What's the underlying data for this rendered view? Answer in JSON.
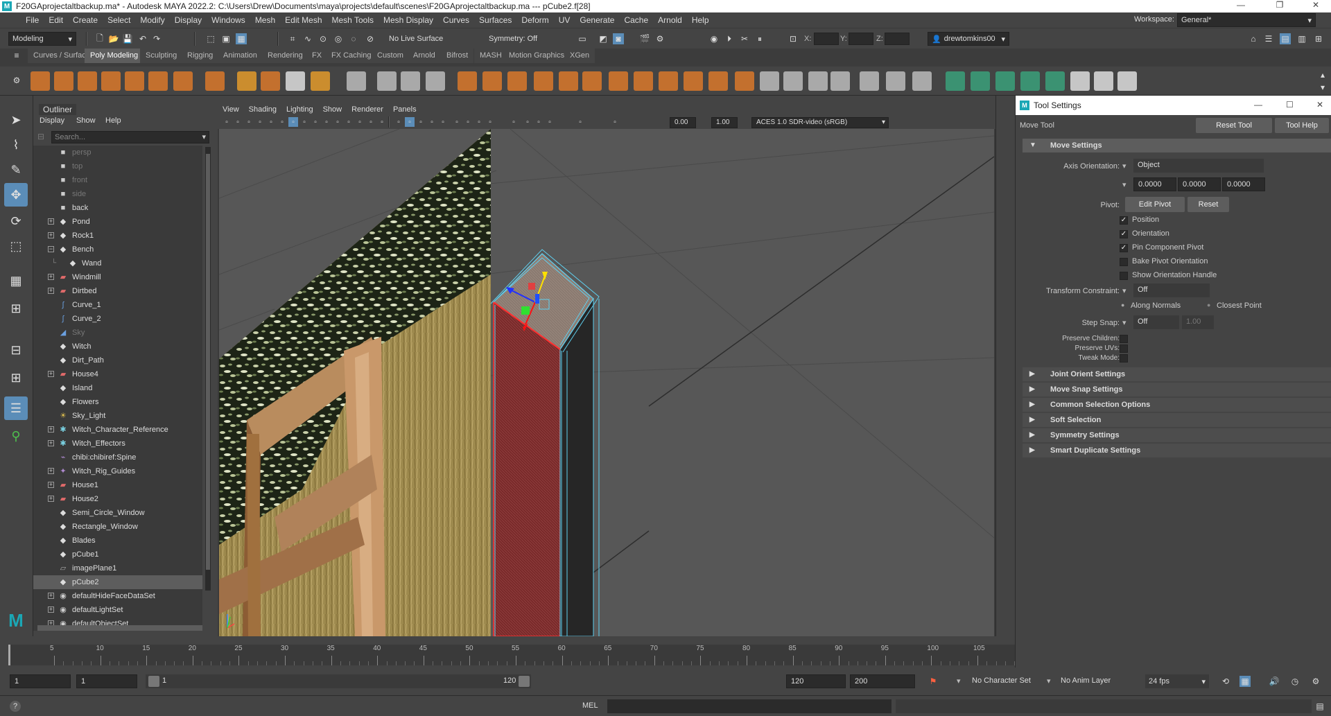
{
  "window": {
    "title": "F20GAprojectaltbackup.ma* - Autodesk MAYA 2022.2: C:\\Users\\Drew\\Documents\\maya\\projects\\default\\scenes\\F20GAprojectaltbackup.ma  ---  pCube2.f[28]",
    "workspace_label": "Workspace:",
    "workspace_value": "General*"
  },
  "menubar": [
    "File",
    "Edit",
    "Create",
    "Select",
    "Modify",
    "Display",
    "Windows",
    "Mesh",
    "Edit Mesh",
    "Mesh Tools",
    "Mesh Display",
    "Curves",
    "Surfaces",
    "Deform",
    "UV",
    "Generate",
    "Cache",
    "Arnold",
    "Help"
  ],
  "statusline": {
    "mode": "Modeling",
    "live_surface": "No Live Surface",
    "symmetry": "Symmetry: Off",
    "x_label": "X:",
    "y_label": "Y:",
    "z_label": "Z:",
    "user": "drewtomkins00"
  },
  "shelf_tabs": [
    "Curves / Surfaces",
    "Poly Modeling",
    "Sculpting",
    "Rigging",
    "Animation",
    "Rendering",
    "FX",
    "FX Caching",
    "Custom",
    "Arnold",
    "Bifrost",
    "MASH",
    "Motion Graphics",
    "XGen"
  ],
  "shelf_active": "Poly Modeling",
  "outliner": {
    "title": "Outliner",
    "menus": [
      "Display",
      "Show",
      "Help"
    ],
    "search_placeholder": "Search...",
    "items": [
      {
        "label": "persp",
        "icon": "camera-icon",
        "dim": true,
        "exp": false,
        "indent": 0
      },
      {
        "label": "top",
        "icon": "camera-icon",
        "dim": true,
        "exp": false,
        "indent": 0
      },
      {
        "label": "front",
        "icon": "camera-icon",
        "dim": true,
        "exp": false,
        "indent": 0
      },
      {
        "label": "side",
        "icon": "camera-icon",
        "dim": true,
        "exp": false,
        "indent": 0
      },
      {
        "label": "back",
        "icon": "camera-icon",
        "dim": false,
        "exp": false,
        "indent": 0
      },
      {
        "label": "Pond",
        "icon": "transform-icon",
        "dim": false,
        "exp": true,
        "indent": 0
      },
      {
        "label": "Rock1",
        "icon": "transform-icon",
        "dim": false,
        "exp": true,
        "indent": 0
      },
      {
        "label": "Bench",
        "icon": "transform-icon",
        "dim": false,
        "exp": "open",
        "indent": 0
      },
      {
        "label": "Wand",
        "icon": "transform-icon",
        "dim": false,
        "exp": false,
        "indent": 1
      },
      {
        "label": "Windmill",
        "icon": "mesh-icon",
        "dim": false,
        "exp": true,
        "indent": 0
      },
      {
        "label": "Dirtbed",
        "icon": "mesh-icon",
        "dim": false,
        "exp": true,
        "indent": 0
      },
      {
        "label": "Curve_1",
        "icon": "curve-icon",
        "dim": false,
        "exp": false,
        "indent": 0
      },
      {
        "label": "Curve_2",
        "icon": "curve-icon",
        "dim": false,
        "exp": false,
        "indent": 0
      },
      {
        "label": "Sky",
        "icon": "sky-icon",
        "dim": true,
        "exp": false,
        "indent": 0
      },
      {
        "label": "Witch",
        "icon": "transform-icon",
        "dim": false,
        "exp": false,
        "indent": 0
      },
      {
        "label": "Dirt_Path",
        "icon": "transform-icon",
        "dim": false,
        "exp": false,
        "indent": 0
      },
      {
        "label": "House4",
        "icon": "mesh-icon",
        "dim": false,
        "exp": true,
        "indent": 0
      },
      {
        "label": "Island",
        "icon": "transform-icon",
        "dim": false,
        "exp": false,
        "indent": 0
      },
      {
        "label": "Flowers",
        "icon": "transform-icon",
        "dim": false,
        "exp": false,
        "indent": 0
      },
      {
        "label": "Sky_Light",
        "icon": "light-icon",
        "dim": false,
        "exp": false,
        "indent": 0
      },
      {
        "label": "Witch_Character_Reference",
        "icon": "joint-icon",
        "dim": false,
        "exp": true,
        "indent": 0
      },
      {
        "label": "Witch_Effectors",
        "icon": "joint-icon",
        "dim": false,
        "exp": true,
        "indent": 0
      },
      {
        "label": "chibi:chibiref:Spine",
        "icon": "spine-icon",
        "dim": false,
        "exp": false,
        "indent": 0
      },
      {
        "label": "Witch_Rig_Guides",
        "icon": "guide-icon",
        "dim": false,
        "exp": true,
        "indent": 0
      },
      {
        "label": "House1",
        "icon": "mesh-icon",
        "dim": false,
        "exp": true,
        "indent": 0
      },
      {
        "label": "House2",
        "icon": "mesh-icon",
        "dim": false,
        "exp": true,
        "indent": 0
      },
      {
        "label": "Semi_Circle_Window",
        "icon": "transform-icon",
        "dim": false,
        "exp": false,
        "indent": 0
      },
      {
        "label": "Rectangle_Window",
        "icon": "transform-icon",
        "dim": false,
        "exp": false,
        "indent": 0
      },
      {
        "label": "Blades",
        "icon": "transform-icon",
        "dim": false,
        "exp": false,
        "indent": 0
      },
      {
        "label": "pCube1",
        "icon": "transform-icon",
        "dim": false,
        "exp": false,
        "indent": 0
      },
      {
        "label": "imagePlane1",
        "icon": "image-plane-icon",
        "dim": false,
        "exp": false,
        "indent": 0
      },
      {
        "label": "pCube2",
        "icon": "transform-icon",
        "dim": false,
        "exp": false,
        "indent": 0,
        "selected": true
      },
      {
        "label": "defaultHideFaceDataSet",
        "icon": "set-icon",
        "dim": false,
        "exp": true,
        "indent": 0
      },
      {
        "label": "defaultLightSet",
        "icon": "set-icon",
        "dim": false,
        "exp": true,
        "indent": 0
      },
      {
        "label": "defaultObjectSet",
        "icon": "set-icon",
        "dim": false,
        "exp": true,
        "indent": 0
      }
    ]
  },
  "viewport": {
    "menus": [
      "View",
      "Shading",
      "Lighting",
      "Show",
      "Renderer",
      "Panels"
    ],
    "exposure": "0.00",
    "gamma": "1.00",
    "color_space": "ACES 1.0 SDR-video (sRGB)"
  },
  "tool_settings": {
    "window_title": "Tool Settings",
    "tool_name": "Move Tool",
    "reset_tool": "Reset Tool",
    "tool_help": "Tool Help",
    "move_settings": "Move Settings",
    "axis_orientation_label": "Axis Orientation:",
    "axis_orientation_value": "Object",
    "axis_values": [
      "0.0000",
      "0.0000",
      "0.0000"
    ],
    "pivot_label": "Pivot:",
    "edit_pivot": "Edit Pivot",
    "reset": "Reset",
    "checks": [
      {
        "label": "Position",
        "checked": true
      },
      {
        "label": "Orientation",
        "checked": true
      },
      {
        "label": "Pin Component Pivot",
        "checked": true
      },
      {
        "label": "Bake Pivot Orientation",
        "checked": false
      },
      {
        "label": "Show Orientation Handle",
        "checked": false
      }
    ],
    "transform_constraint_label": "Transform Constraint:",
    "transform_constraint_value": "Off",
    "along_normals": "Along Normals",
    "closest_point": "Closest Point",
    "step_snap_label": "Step Snap:",
    "step_snap_value": "Off",
    "step_snap_num": "1.00",
    "preserve_children": "Preserve Children:",
    "preserve_uvs": "Preserve UVs:",
    "tweak_mode": "Tweak Mode:",
    "sections": [
      "Joint Orient Settings",
      "Move Snap Settings",
      "Common Selection Options",
      "Soft Selection",
      "Symmetry Settings",
      "Smart Duplicate Settings"
    ]
  },
  "timeline": {
    "ticks": [
      "5",
      "10",
      "15",
      "20",
      "25",
      "30",
      "35",
      "40",
      "45",
      "50",
      "55",
      "60",
      "65",
      "70",
      "75",
      "80",
      "85",
      "90",
      "95",
      "100",
      "105"
    ]
  },
  "range": {
    "start": "1",
    "current": "1",
    "slider_start": "1",
    "slider_end": "120",
    "end": "120",
    "anim_end": "200",
    "character_set": "No Character Set",
    "anim_layer": "No Anim Layer",
    "fps": "24 fps"
  },
  "cmdline": {
    "lang": "MEL"
  },
  "colors": {
    "accent": "#5b8db8",
    "selected_face": "#8a2f2f",
    "wire": "#5fd0f0",
    "edge_selected": "#ff3030"
  }
}
